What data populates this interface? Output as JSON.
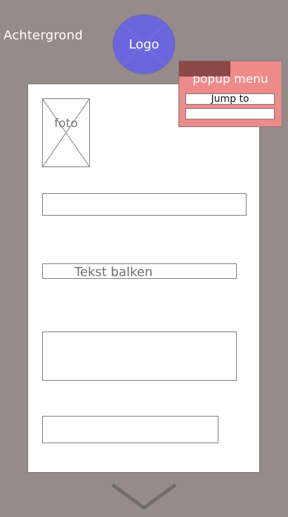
{
  "background_label": "Achtergrond",
  "logo": {
    "label": "Logo",
    "color": "#6b66dd"
  },
  "photo": {
    "label": "foto"
  },
  "text_bar": {
    "label": "Tekst balken"
  },
  "popup": {
    "title": "popup menu",
    "field1": "Jump to",
    "field2": "",
    "color": "#ed8a8a",
    "tab_color": "#8c4747"
  },
  "colors": {
    "background": "#968b8b",
    "card": "#ffffff",
    "chevron": "#6e6e6e"
  },
  "icons": {
    "scroll_down": "chevron-down-icon"
  }
}
